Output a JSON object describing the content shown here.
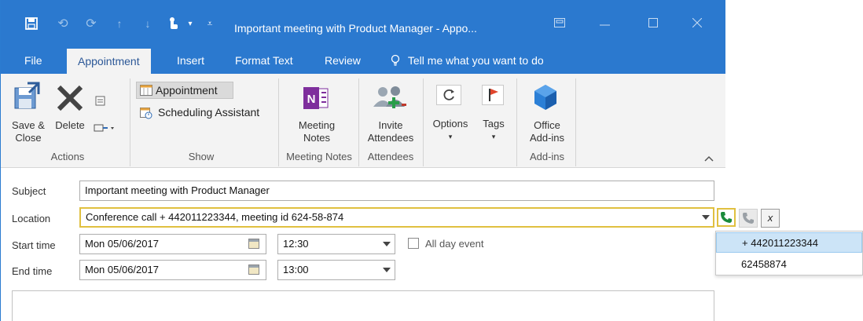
{
  "window": {
    "title": "Important meeting with Product Manager  -  Appo...",
    "qat_icons": [
      "save-icon",
      "undo-icon",
      "redo-icon",
      "up-arrow-icon",
      "down-arrow-icon",
      "touch-mode-icon",
      "customize-qat-icon"
    ],
    "controls": [
      "ribbon-display-icon",
      "minimize-icon",
      "maximize-icon",
      "close-icon"
    ]
  },
  "tabs": [
    {
      "label": "File"
    },
    {
      "label": "Appointment"
    },
    {
      "label": "Insert"
    },
    {
      "label": "Format Text"
    },
    {
      "label": "Review"
    }
  ],
  "tell_me": "Tell me what you want to do",
  "ribbon": {
    "actions": {
      "save_close_line1": "Save &",
      "save_close_line2": "Close",
      "delete": "Delete",
      "group_label": "Actions"
    },
    "show": {
      "appointment": "Appointment",
      "scheduling": "Scheduling Assistant",
      "group_label": "Show"
    },
    "meeting_notes": {
      "line1": "Meeting",
      "line2": "Notes",
      "group_label": "Meeting Notes",
      "onenote_letter": "N"
    },
    "attendees": {
      "line1": "Invite",
      "line2": "Attendees",
      "group_label": "Attendees"
    },
    "options": {
      "label": "Options"
    },
    "tags": {
      "label": "Tags"
    },
    "addins": {
      "line1": "Office",
      "line2": "Add-ins",
      "group_label": "Add-ins"
    }
  },
  "form": {
    "subject_label": "Subject",
    "subject_value": "Important meeting with Product Manager",
    "location_label": "Location",
    "location_value": "Conference call + 442011223344, meeting id 624-58-874",
    "start_label": "Start time",
    "start_date": "Mon 05/06/2017",
    "start_time": "12:30",
    "end_label": "End time",
    "end_date": "Mon 05/06/2017",
    "end_time": "13:00",
    "all_day_label": "All day event",
    "all_day_checked": false,
    "close_symbol": "x"
  },
  "popup": {
    "items": [
      "+ 442011223344",
      "62458874"
    ],
    "selected_index": 0
  },
  "colors": {
    "titlebar": "#2b79cf",
    "ribbon": "#f3f3f3",
    "phone_green": "#1a8a3a",
    "highlight_border": "#e0c040",
    "selected_item": "#cce4f7"
  }
}
